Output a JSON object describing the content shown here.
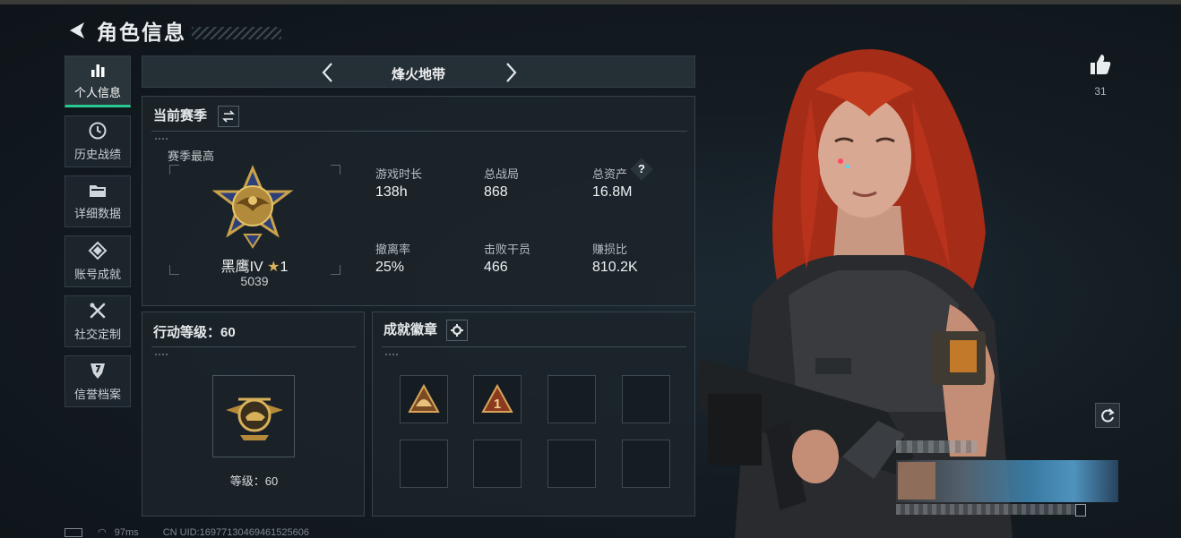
{
  "header": {
    "title": "角色信息"
  },
  "sidebar": {
    "items": [
      {
        "label": "个人信息",
        "icon": "bar-chart-icon",
        "active": true
      },
      {
        "label": "历史战绩",
        "icon": "clock-icon"
      },
      {
        "label": "详细数据",
        "icon": "folder-icon"
      },
      {
        "label": "账号成就",
        "icon": "medal-icon"
      },
      {
        "label": "社交定制",
        "icon": "tools-icon"
      },
      {
        "label": "信誉档案",
        "icon": "shield-icon"
      }
    ]
  },
  "mode": {
    "name": "烽火地带"
  },
  "season": {
    "title": "当前赛季",
    "best_label": "赛季最高",
    "rank_name": "黑鹰IV",
    "rank_stars": "1",
    "rank_points": "5039",
    "stats": [
      {
        "label": "游戏时长",
        "value": "138h"
      },
      {
        "label": "总战局",
        "value": "868"
      },
      {
        "label": "总资产",
        "value": "16.8M",
        "help": true
      },
      {
        "label": "撤离率",
        "value": "25%"
      },
      {
        "label": "击败干员",
        "value": "466"
      },
      {
        "label": "赚损比",
        "value": "810.2K"
      }
    ]
  },
  "level": {
    "title": "行动等级：60",
    "caption": "等级：60"
  },
  "achievements": {
    "title": "成就徽章",
    "slots_total": 8,
    "slots_filled": 2
  },
  "likes": {
    "count": "31"
  },
  "footer": {
    "ping": "97ms",
    "uid": "CN UID:16977130469461525606"
  },
  "colors": {
    "accent": "#28c990",
    "hair": "#b8321c",
    "gold": "#c9a24a"
  }
}
